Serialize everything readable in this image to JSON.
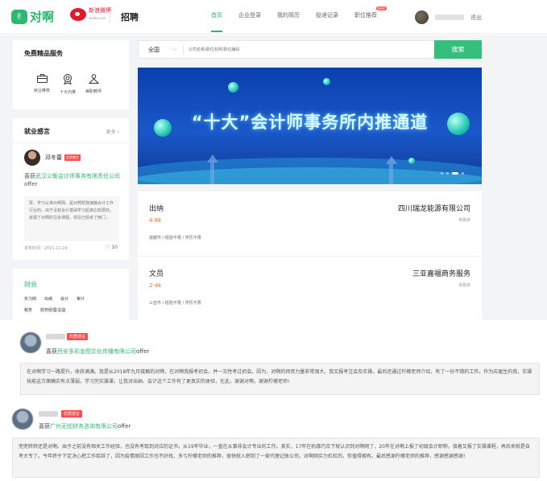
{
  "header": {
    "logo_mark": "✌",
    "logo_text": "对啊",
    "partner_line1": "新浪微博",
    "partner_line2": "weibo.com",
    "brand_title": "招聘",
    "nav": [
      {
        "label": "首页",
        "active": true
      },
      {
        "label": "企业登录",
        "active": false
      },
      {
        "label": "我的简历",
        "active": false
      },
      {
        "label": "投递记录",
        "active": false
      },
      {
        "label": "职位推荐",
        "active": false,
        "badge": "NEW"
      }
    ],
    "logout": "退出"
  },
  "services": {
    "title": "免费精品服务",
    "items": [
      {
        "label": "就业推荐",
        "icon": "briefcase-icon"
      },
      {
        "label": "十大内推",
        "icon": "award-icon"
      },
      {
        "label": "兼职教师",
        "icon": "teacher-icon"
      }
    ]
  },
  "story_panel": {
    "title": "就业感言",
    "more": "更多",
    "name": "邓冬蕾",
    "tag": "优质感言",
    "offer_prefix": "喜获",
    "offer_company": "武汉公衡会计师事务有限责任公司",
    "offer_suffix": "offer",
    "quote": "赞，学习认准对啊网。是对啊帮我接触会计工作行业的。由于没有会计基础学习起来比较费劲，就报了对啊的注会课程，现在已经考了两门...",
    "date": "发布时间：2021.11.24",
    "likes": "10"
  },
  "categories": {
    "title": "财会",
    "row1": [
      "实习岗",
      "出纳",
      "会计",
      "审计"
    ],
    "row2": [
      "税务",
      "财务经理/总监"
    ]
  },
  "search": {
    "region": "全国",
    "placeholder": "公司名称/职位名称/职位编码",
    "button": "搜索"
  },
  "banner": {
    "text": "“十大”会计师事务所内推通道"
  },
  "jobs": [
    {
      "title": "出纳",
      "salary": "4-6k",
      "meta": "成都市 / 经验不限 / 学历不限",
      "company": "四川瑞龙能源有限公司",
      "funding": "未融资"
    },
    {
      "title": "文员",
      "salary": "2-4k",
      "meta": "三亚市 / 经验不限 / 学历不限",
      "company": "三亚嘉福商务服务",
      "funding": "未融资"
    }
  ],
  "stories": [
    {
      "tag": "优质感言",
      "offer_prefix": "喜获",
      "offer_company": "西安多彩金图文化传播有限公司",
      "offer_suffix": "offer",
      "quote": "在对啊学习一路提升，收获满满。我是从2018年九月接触的对啊，在对啊我报考初会，并一次性考过初会。因为，对啊的师资力量非常强大，我又报考注会及实操，最后还通过柠檬老师介绍，有了一份不错的工作。作为应届生的我，实操技能这方面确实有点薄弱，学习完实操课，让我对出纳、会计这个工作有了更真实的体验，在此，谢谢对啊，谢谢柠檬老师!"
    },
    {
      "tag": "优质感言",
      "offer_prefix": "喜获",
      "offer_company": "广州无忧财务咨询有限公司",
      "offer_suffix": "offer",
      "quote": "兜兜转转还是对啊。由于之前没有相关工作经验，也没有考取到对应的证书，从19年毕业，一直在从事非会计专业的工作。其实，17年在机缘巧合下就认识到对啊网了，20年在对啊上报了初级会计职称，接着又报了实操课程，再后来就是自考大专了。今年终于下定决心把工作给辞了，因为疫情原因工作也不好找，多亏柠檬老师的推荐，很快就入职到了一家代理记账公司，对啊网实力杠杠的，你值得拥有。最后感谢柠檬老师的推荐，感谢感谢感谢!"
    }
  ]
}
